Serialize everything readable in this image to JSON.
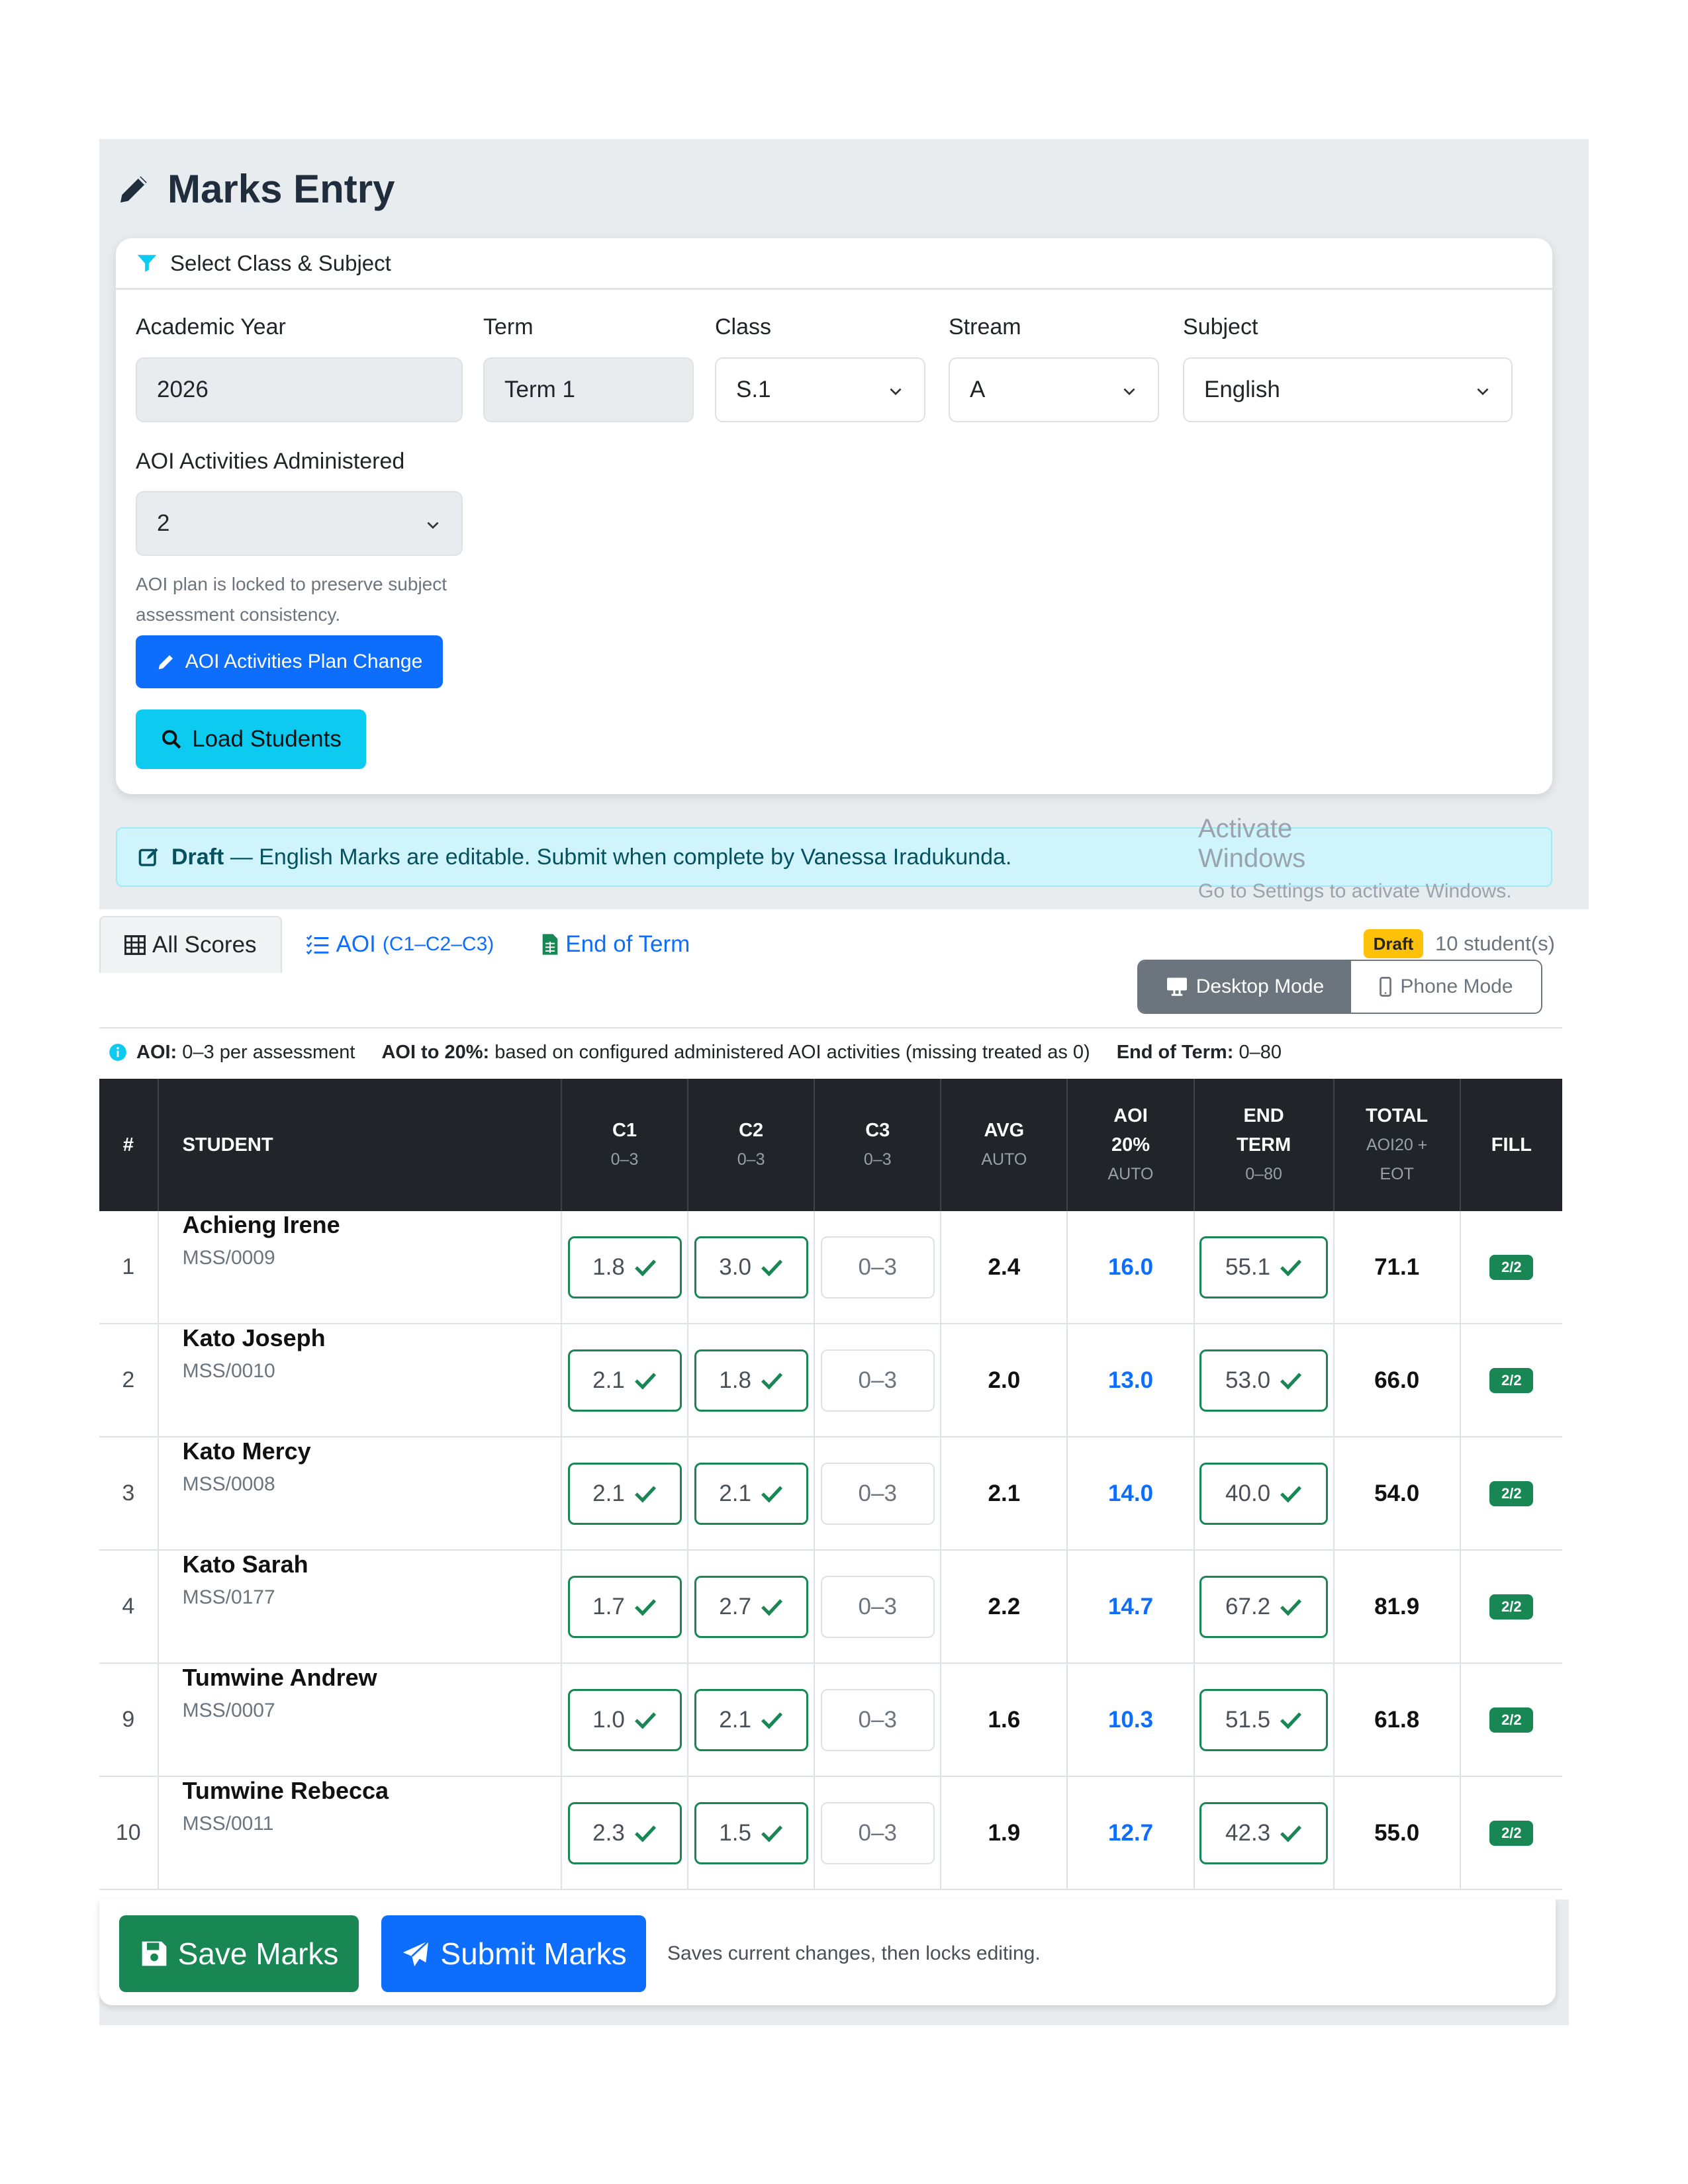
{
  "page": {
    "title": "Marks Entry"
  },
  "filter": {
    "header": "Select Class & Subject",
    "academic_year": {
      "label": "Academic Year",
      "value": "2026"
    },
    "term": {
      "label": "Term",
      "value": "Term 1"
    },
    "class": {
      "label": "Class",
      "value": "S.1"
    },
    "stream": {
      "label": "Stream",
      "value": "A"
    },
    "subject": {
      "label": "Subject",
      "value": "English"
    },
    "aoi_activities": {
      "label": "AOI Activities Administered",
      "value": "2"
    },
    "aoi_help": "AOI plan is locked to preserve subject assessment consistency.",
    "plan_change_button": "AOI Activities Plan Change",
    "load_button": "Load Students"
  },
  "alert": {
    "status": "Draft",
    "message": " — English Marks are editable. Submit when complete by Vanessa Iradukunda."
  },
  "watermark": {
    "line1": "Activate Windows",
    "line2": "Go to Settings to activate Windows."
  },
  "tabs": [
    {
      "label": "All Scores",
      "sub": ""
    },
    {
      "label": "AOI",
      "sub": "(C1–C2–C3)"
    },
    {
      "label": "End of Term",
      "sub": ""
    }
  ],
  "status_badge": "Draft",
  "student_count": "10 student(s)",
  "modes": {
    "desktop": "Desktop Mode",
    "phone": "Phone Mode"
  },
  "legend": {
    "aoi_label": "AOI:",
    "aoi_text": "0–3 per assessment",
    "aoi20_label": "AOI to 20%:",
    "aoi20_text": "based on configured administered AOI activities (missing treated as 0)",
    "eot_label": "End of Term:",
    "eot_text": "0–80"
  },
  "columns": {
    "num": "#",
    "student": "STUDENT",
    "c1": "C1",
    "c1_sub": "0–3",
    "c2": "C2",
    "c2_sub": "0–3",
    "c3": "C3",
    "c3_sub": "0–3",
    "avg": "AVG",
    "avg_sub": "AUTO",
    "aoi1": "AOI",
    "aoi2": "20%",
    "aoi_sub": "AUTO",
    "end1": "END",
    "end2": "TERM",
    "end_sub": "0–80",
    "total": "TOTAL",
    "total_sub1": "AOI20 +",
    "total_sub2": "EOT",
    "fill": "FILL"
  },
  "rows": [
    {
      "num": "1",
      "name": "Achieng Irene",
      "id": "MSS/0009",
      "c1": "1.8",
      "c2": "3.0",
      "c3": "0–3",
      "avg": "2.4",
      "aoi20": "16.0",
      "eot": "55.1",
      "total": "71.1",
      "fill": "2/2"
    },
    {
      "num": "2",
      "name": "Kato Joseph",
      "id": "MSS/0010",
      "c1": "2.1",
      "c2": "1.8",
      "c3": "0–3",
      "avg": "2.0",
      "aoi20": "13.0",
      "eot": "53.0",
      "total": "66.0",
      "fill": "2/2"
    },
    {
      "num": "3",
      "name": "Kato Mercy",
      "id": "MSS/0008",
      "c1": "2.1",
      "c2": "2.1",
      "c3": "0–3",
      "avg": "2.1",
      "aoi20": "14.0",
      "eot": "40.0",
      "total": "54.0",
      "fill": "2/2"
    },
    {
      "num": "4",
      "name": "Kato Sarah",
      "id": "MSS/0177",
      "c1": "1.7",
      "c2": "2.7",
      "c3": "0–3",
      "avg": "2.2",
      "aoi20": "14.7",
      "eot": "67.2",
      "total": "81.9",
      "fill": "2/2"
    },
    {
      "num": "9",
      "name": "Tumwine Andrew",
      "id": "MSS/0007",
      "c1": "1.0",
      "c2": "2.1",
      "c3": "0–3",
      "avg": "1.6",
      "aoi20": "10.3",
      "eot": "51.5",
      "total": "61.8",
      "fill": "2/2"
    },
    {
      "num": "10",
      "name": "Tumwine Rebecca",
      "id": "MSS/0011",
      "c1": "2.3",
      "c2": "1.5",
      "c3": "0–3",
      "avg": "1.9",
      "aoi20": "12.7",
      "eot": "42.3",
      "total": "55.0",
      "fill": "2/2"
    }
  ],
  "footer": {
    "save_button": "Save Marks",
    "submit_button": "Submit Marks",
    "hint": "Saves current changes, then locks editing."
  },
  "colors": {
    "primary": "#0d6efd",
    "success": "#198754",
    "info": "#0dcaf0",
    "warning": "#ffc107",
    "dark": "#212529"
  }
}
